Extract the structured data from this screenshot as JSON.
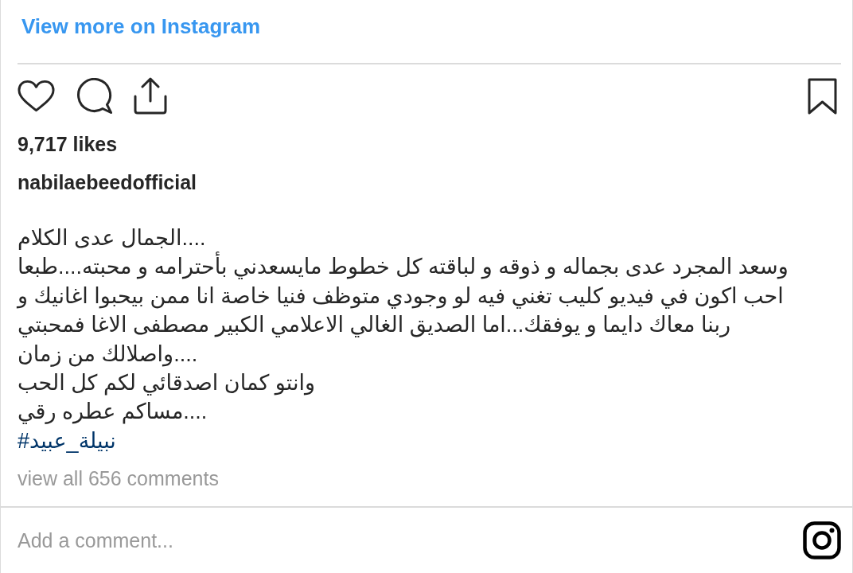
{
  "link": {
    "label": "View more on Instagram"
  },
  "likes": "9,717 likes",
  "username": "nabilaebeedofficial",
  "caption": {
    "lines": [
      "الجمال عدى الكلام....",
      "وسعد المجرد عدى بجماله و ذوقه و لباقته كل خطوط مايسعدني بأحترامه و محبته....طبعا",
      "احب اكون في فيديو كليب تغني فيه لو وجودي متوظف فنيا خاصة انا ممن بيحبوا اغانيك و",
      "ربنا معاك دايما و يوفقك...اما الصديق الغالي الاعلامي الكبير مصطفى الاغا فمحبتي",
      "واصلالك من زمان....",
      "وانتو كمان اصدقائي لكم كل الحب",
      "مساكم عطره رقي...."
    ],
    "hashtag": "#نبيلة_عبيد"
  },
  "comments_link": "view all 656 comments",
  "comment_field": {
    "placeholder": "Add a comment..."
  }
}
